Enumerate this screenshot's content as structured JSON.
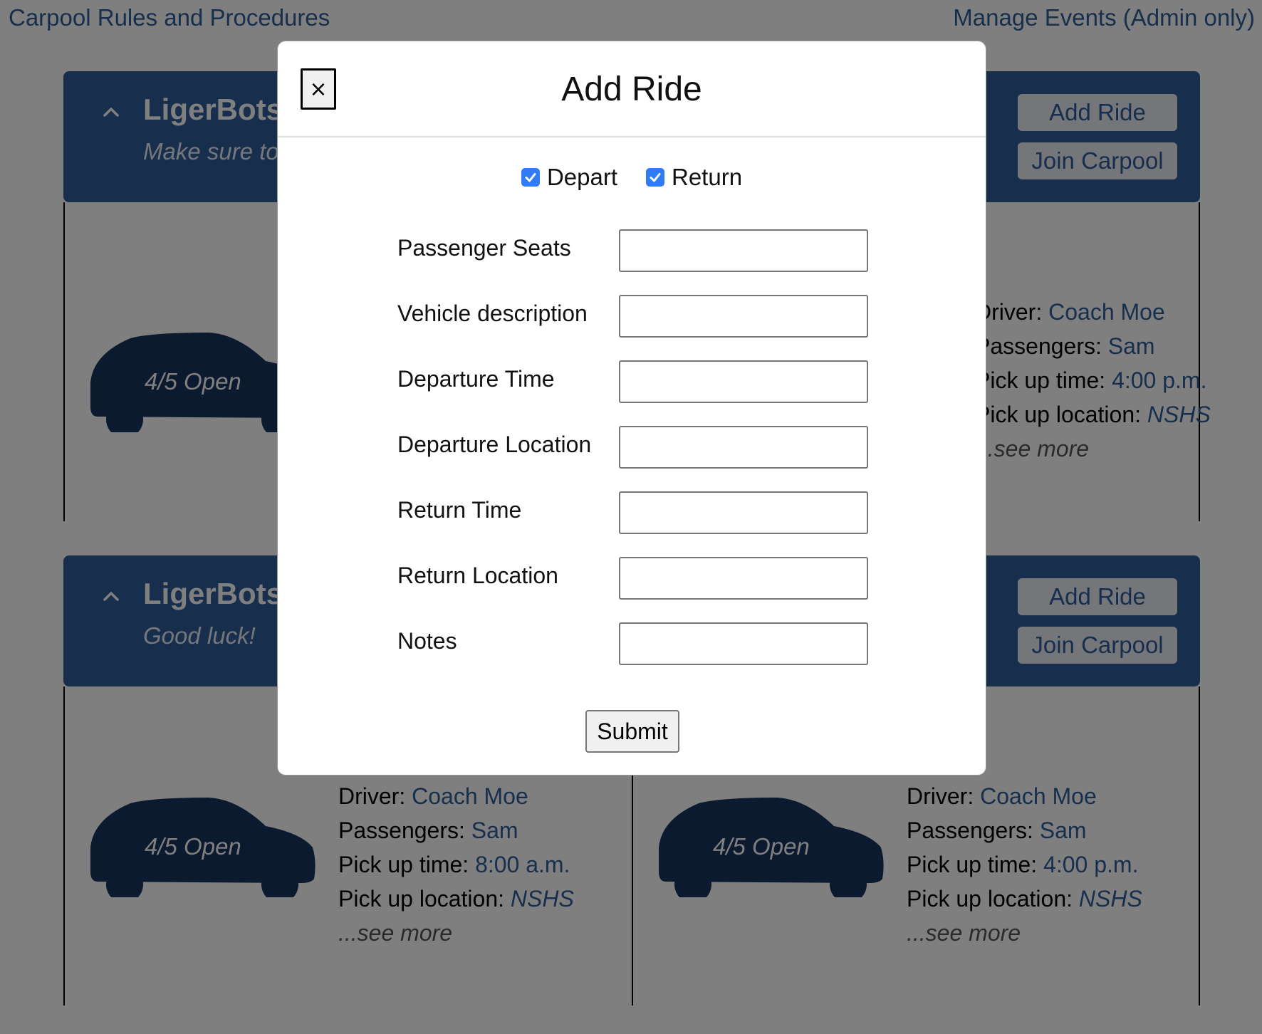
{
  "nav": {
    "rules_link": "Carpool Rules and Procedures",
    "admin_link": "Manage Events (Admin only)"
  },
  "events": [
    {
      "title": "LigerBots",
      "subtitle": "Make sure to",
      "add_ride_label": "Add Ride",
      "join_label": "Join Carpool",
      "rides": [
        {
          "seats_open": "4/5 Open",
          "driver_label": "Driver:",
          "driver": "Coach Moe",
          "passengers_label": "Passengers:",
          "passengers": "Sam",
          "time_label": "Pick up time:",
          "time": "4:00 p.m.",
          "location_label": "Pick up location:",
          "location": "NSHS",
          "see_more": "...see more"
        }
      ]
    },
    {
      "title": "LigerBots",
      "subtitle": "Good luck!",
      "add_ride_label": "Add Ride",
      "join_label": "Join Carpool",
      "rides": [
        {
          "seats_open": "4/5 Open",
          "driver_label": "Driver:",
          "driver": "Coach Moe",
          "passengers_label": "Passengers:",
          "passengers": "Sam",
          "time_label": "Pick up time:",
          "time": "8:00 a.m.",
          "location_label": "Pick up location:",
          "location": "NSHS",
          "see_more": "...see more"
        },
        {
          "seats_open": "4/5 Open",
          "driver_label": "Driver:",
          "driver": "Coach Moe",
          "passengers_label": "Passengers:",
          "passengers": "Sam",
          "time_label": "Pick up time:",
          "time": "4:00 p.m.",
          "location_label": "Pick up location:",
          "location": "NSHS",
          "see_more": "...see more"
        }
      ]
    }
  ],
  "modal": {
    "close_label": "×",
    "title": "Add Ride",
    "depart": {
      "label": "Depart",
      "checked": true
    },
    "return": {
      "label": "Return",
      "checked": true
    },
    "fields": [
      {
        "label": "Passenger Seats",
        "value": ""
      },
      {
        "label": "Vehicle description",
        "value": ""
      },
      {
        "label": "Departure Time",
        "value": ""
      },
      {
        "label": "Departure Location",
        "value": ""
      },
      {
        "label": "Return Time",
        "value": ""
      },
      {
        "label": "Return Location",
        "value": ""
      },
      {
        "label": "Notes",
        "value": ""
      }
    ],
    "submit_label": "Submit"
  },
  "colors": {
    "header_bg": "#2e5c98",
    "link": "#2f5e98",
    "car": "#16345f",
    "checkbox": "#2f7cf6",
    "overlay": "rgba(0,0,0,0.5)"
  },
  "icons": {
    "collapse": "chevron-up-icon",
    "car": "car-icon",
    "close": "close-icon",
    "check": "checkmark-icon"
  }
}
